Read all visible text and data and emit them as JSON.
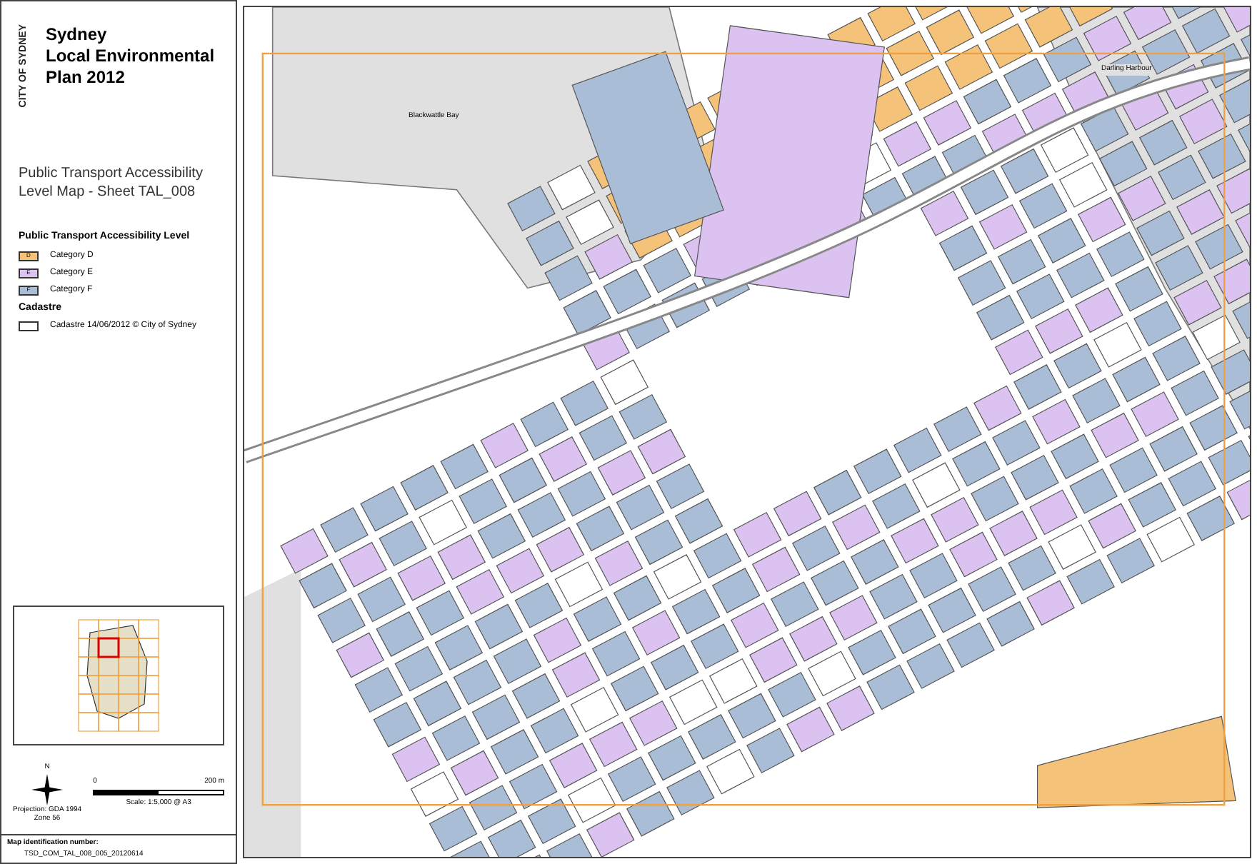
{
  "title": {
    "logo_text": "CITY OF SYDNEY",
    "lines": [
      "Sydney",
      "Local Environmental",
      "Plan 2012"
    ]
  },
  "map_title": "Public Transport Accessibility Level Map - Sheet TAL_008",
  "legend": {
    "heading": "Public Transport Accessibility Level",
    "items": [
      {
        "kind": "swatch",
        "code": "D",
        "label": "Category D",
        "color": "#f5c27a"
      },
      {
        "kind": "swatch",
        "code": "E",
        "label": "Category E",
        "color": "#dcc2f0"
      },
      {
        "kind": "swatch",
        "code": "F",
        "label": "Category F",
        "color": "#a9bdd6"
      }
    ],
    "cadastre_heading": "Cadastre",
    "cadastre_label": "Cadastre 14/06/2012 © City of Sydney"
  },
  "scale": {
    "start": "0",
    "end": "200 m",
    "text": "Scale: 1:5,000 @ A3"
  },
  "north": "N",
  "projection": [
    "Projection: GDA 1994",
    "Zone 56"
  ],
  "map_id": {
    "label": "Map identification number:",
    "value": "TSD_COM_TAL_008_005_20120614"
  },
  "map": {
    "labels": [
      "Blackwattle Bay",
      "Darling Harbour"
    ]
  }
}
